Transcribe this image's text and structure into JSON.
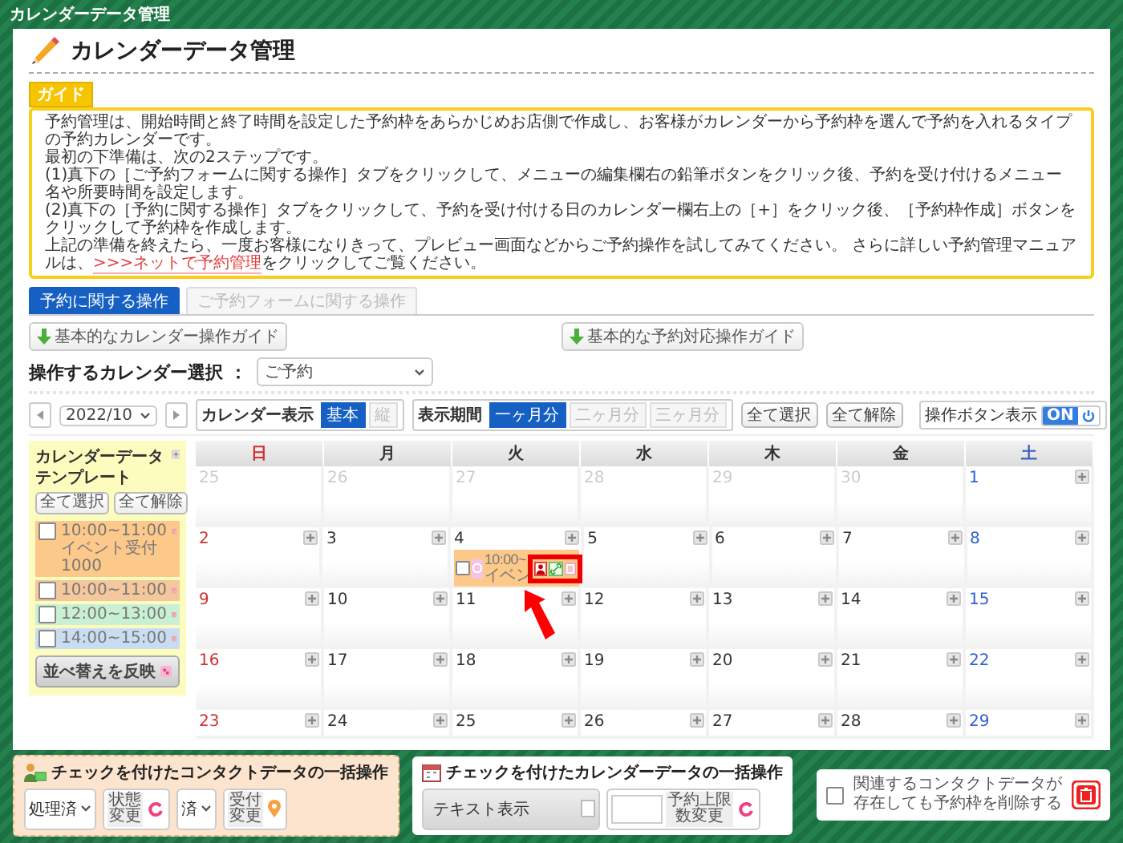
{
  "window": {
    "title": "カレンダーデータ管理"
  },
  "page_title": "カレンダーデータ管理",
  "guide": {
    "label": "ガイド",
    "lines": [
      "予約管理は、開始時間と終了時間を設定した予約枠をあらかじめお店側で作成し、お客様がカレンダーから予約枠を選んで予約を入れるタイプの予約カレンダーです。",
      "最初の下準備は、次の2ステップです。",
      "(1)真下の［ご予約フォームに関する操作］タブをクリックして、メニューの編集欄右の鉛筆ボタンをクリック後、予約を受け付けるメニュー名や所要時間を設定します。",
      "(2)真下の［予約に関する操作］タブをクリックして、予約を受け付ける日のカレンダー欄右上の［+］をクリック後、［予約枠作成］ボタンをクリックして予約枠を作成します。"
    ],
    "closing": {
      "before": "上記の準備を終えたら、一度お客様になりきって、プレビュー画面などからご予約操作を試してみてください。 さらに詳しい予約管理マニュアルは、",
      "link": ">>>ネットで予約管理",
      "after": "をクリックしてご覧ください。"
    }
  },
  "tabs": [
    {
      "label": "予約に関する操作",
      "selected": true
    },
    {
      "label": "ご予約フォームに関する操作",
      "selected": false
    }
  ],
  "guide_buttons": [
    "基本的なカレンダー操作ガイド",
    "基本的な予約対応操作ガイド"
  ],
  "calendar_select": {
    "label": "操作するカレンダー選択 ：",
    "value": "ご予約"
  },
  "toolbar": {
    "month": "2022/10",
    "display": {
      "label": "カレンダー表示",
      "options": [
        {
          "label": "基本",
          "selected": true
        },
        {
          "label": "縦",
          "selected": false
        }
      ]
    },
    "period": {
      "label": "表示期間",
      "options": [
        {
          "label": "一ヶ月分",
          "selected": true
        },
        {
          "label": "二ヶ月分",
          "selected": false
        },
        {
          "label": "三ヶ月分",
          "selected": false
        }
      ]
    },
    "buttons": [
      "全て選択",
      "全て解除"
    ],
    "op_toggle": {
      "label": "操作ボタン表示",
      "on": true,
      "text": "ON"
    }
  },
  "template": {
    "title": "カレンダーデータテンプレート",
    "buttons": [
      "全て選択",
      "全て解除"
    ],
    "items": [
      {
        "lines": [
          "10:00~11:00",
          "イベント受付",
          "1000"
        ],
        "color": "#fdc98a",
        "checked": false
      },
      {
        "lines": [
          "10:00~11:00"
        ],
        "color": "#f5c79c",
        "checked": false
      },
      {
        "lines": [
          "12:00~13:00"
        ],
        "color": "#c9f0d2",
        "checked": false
      },
      {
        "lines": [
          "14:00~15:00"
        ],
        "color": "#c9ddf2",
        "checked": false
      }
    ],
    "apply_button": "並べ替えを反映"
  },
  "weekdays": [
    {
      "label": "日",
      "kind": "sun"
    },
    {
      "label": "月",
      "kind": "weekday"
    },
    {
      "label": "火",
      "kind": "weekday"
    },
    {
      "label": "水",
      "kind": "weekday"
    },
    {
      "label": "木",
      "kind": "weekday"
    },
    {
      "label": "金",
      "kind": "weekday"
    },
    {
      "label": "土",
      "kind": "sat"
    }
  ],
  "weeks": [
    {
      "days": [
        {
          "day": "25",
          "outside": true
        },
        {
          "day": "26",
          "outside": true
        },
        {
          "day": "27",
          "outside": true
        },
        {
          "day": "28",
          "outside": true
        },
        {
          "day": "29",
          "outside": true
        },
        {
          "day": "30",
          "outside": true
        },
        {
          "day": "1",
          "outside": false
        }
      ]
    },
    {
      "days": [
        {
          "day": "2",
          "outside": false
        },
        {
          "day": "3",
          "outside": false
        },
        {
          "day": "4",
          "outside": false,
          "events": [
            {
              "time": "10:00~",
              "title": "イベン",
              "color": "#fdc98a",
              "checked": false,
              "highlighted": true
            }
          ]
        },
        {
          "day": "5",
          "outside": false
        },
        {
          "day": "6",
          "outside": false
        },
        {
          "day": "7",
          "outside": false
        },
        {
          "day": "8",
          "outside": false
        }
      ]
    },
    {
      "days": [
        {
          "day": "9",
          "outside": false
        },
        {
          "day": "10",
          "outside": false
        },
        {
          "day": "11",
          "outside": false
        },
        {
          "day": "12",
          "outside": false
        },
        {
          "day": "13",
          "outside": false
        },
        {
          "day": "14",
          "outside": false
        },
        {
          "day": "15",
          "outside": false
        }
      ]
    },
    {
      "days": [
        {
          "day": "16",
          "outside": false
        },
        {
          "day": "17",
          "outside": false
        },
        {
          "day": "18",
          "outside": false
        },
        {
          "day": "19",
          "outside": false
        },
        {
          "day": "20",
          "outside": false
        },
        {
          "day": "21",
          "outside": false
        },
        {
          "day": "22",
          "outside": false
        }
      ]
    },
    {
      "days": [
        {
          "day": "23",
          "outside": false
        },
        {
          "day": "24",
          "outside": false
        },
        {
          "day": "25",
          "outside": false
        },
        {
          "day": "26",
          "outside": false
        },
        {
          "day": "27",
          "outside": false
        },
        {
          "day": "28",
          "outside": false
        },
        {
          "day": "29",
          "outside": false
        }
      ]
    }
  ],
  "contact_ops": {
    "title": "チェックを付けたコンタクトデータの一括操作",
    "status_select": "処理済",
    "status_button": "状態変更",
    "reception_select": "済",
    "reception_button": "受付変更"
  },
  "calendar_ops": {
    "title": "チェックを付けたカレンダーデータの一括操作",
    "text_button": "テキスト表示",
    "limit_button": "予約上限数変更"
  },
  "delete_panel": {
    "label": "関連するコンタクトデータが存在しても予約枠を削除する",
    "checked": false
  }
}
